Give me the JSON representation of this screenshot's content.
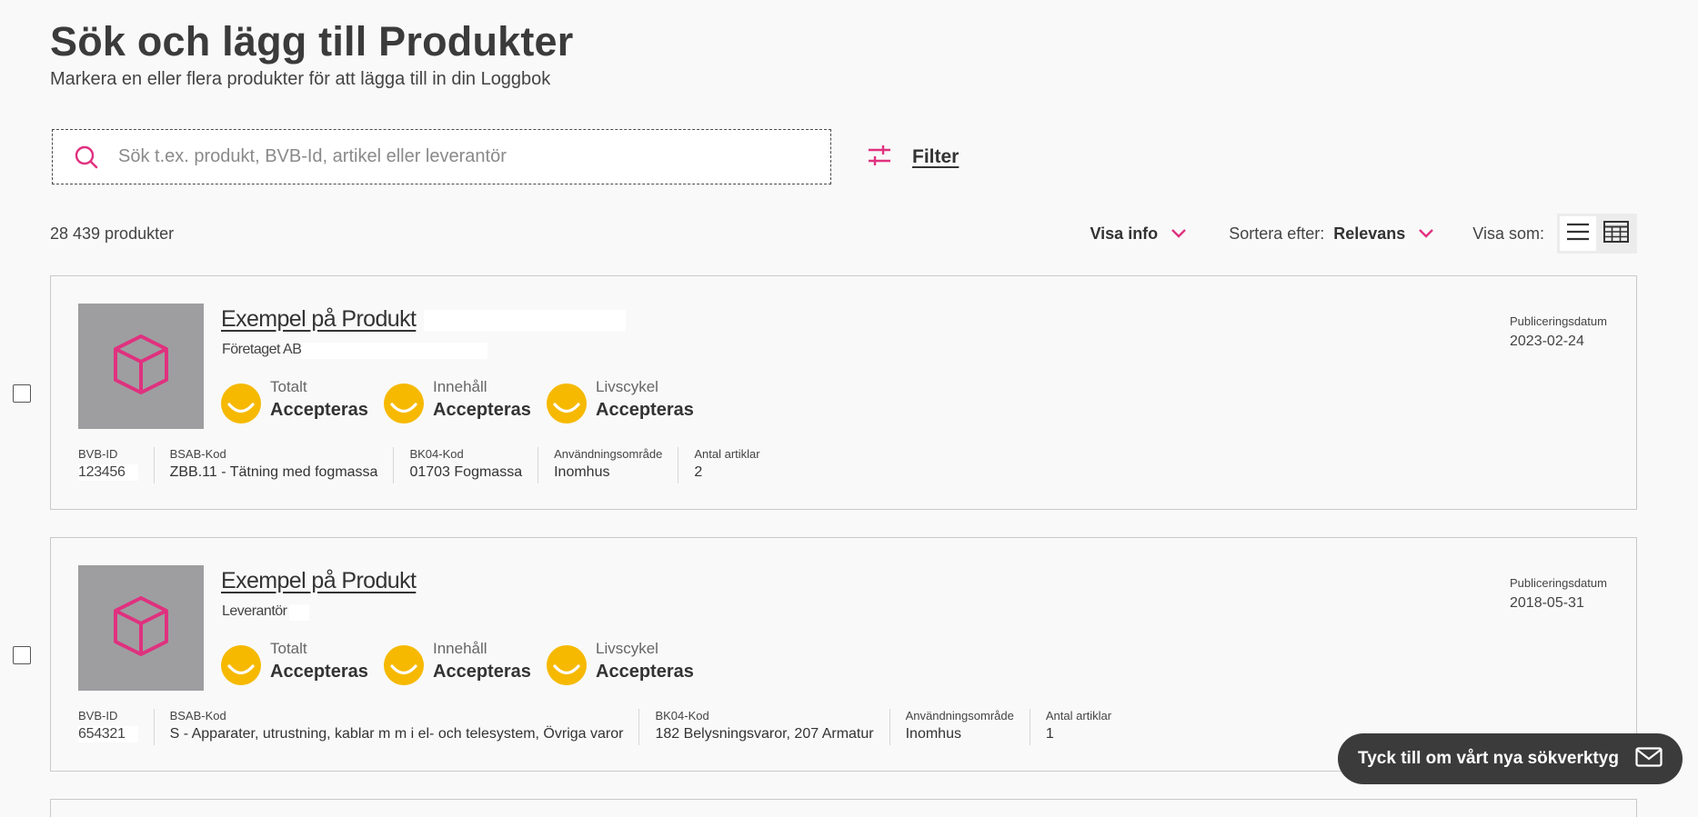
{
  "header": {
    "title": "Sök och lägg till Produkter",
    "subtitle": "Markera en eller flera produkter för att lägga till in din Loggbok"
  },
  "search": {
    "placeholder": "Sök t.ex. produkt, BVB-Id, artikel eller leverantör",
    "value": ""
  },
  "filter": {
    "label": "Filter"
  },
  "results": {
    "count_text": "28 439 produkter"
  },
  "toolbar": {
    "visa_info_label": "Visa info",
    "sort_prefix": "Sortera efter:",
    "sort_value": "Relevans",
    "view_label": "Visa som:"
  },
  "labels": {
    "totalt": "Totalt",
    "innehall": "Innehåll",
    "livscykel": "Livscykel",
    "bvb_id": "BVB-ID",
    "bsab": "BSAB-Kod",
    "bk04": "BK04-Kod",
    "anvandning": "Användningsområde",
    "antal": "Antal artiklar",
    "pub": "Publiceringsdatum"
  },
  "products": [
    {
      "name": "Exempel på Produkt",
      "supplier": "Företaget AB",
      "totalt": "Accepteras",
      "innehall": "Accepteras",
      "livscykel": "Accepteras",
      "bvb_id": "123456",
      "bsab": "ZBB.11 - Tätning med fogmassa",
      "bk04": "01703 Fogmassa",
      "anvandning": "Inomhus",
      "antal": "2",
      "pub_date": "2023-02-24"
    },
    {
      "name": "Exempel på Produkt",
      "supplier": "Leverantör",
      "totalt": "Accepteras",
      "innehall": "Accepteras",
      "livscykel": "Accepteras",
      "bvb_id": "654321",
      "bsab": "S - Apparater, utrustning, kablar m m i el- och telesystem, Övriga varor",
      "bk04": "182 Belysningsvaror, 207 Armatur",
      "anvandning": "Inomhus",
      "antal": "1",
      "pub_date": "2018-05-31"
    }
  ],
  "feedback": {
    "label": "Tyck till om vårt nya sökverktyg"
  },
  "colors": {
    "accent": "#e0317f",
    "rating": "#f6b900",
    "thumb": "#9e9ea0",
    "feedback_bg": "#3b3b3b"
  },
  "icons": {
    "search": "search-icon",
    "filter": "sliders-icon",
    "chevron": "chevron-down-icon",
    "list_view": "list-view-icon",
    "grid_view": "table-view-icon",
    "product": "cube-icon",
    "rating": "smiley-icon",
    "feedback": "mail-icon"
  }
}
